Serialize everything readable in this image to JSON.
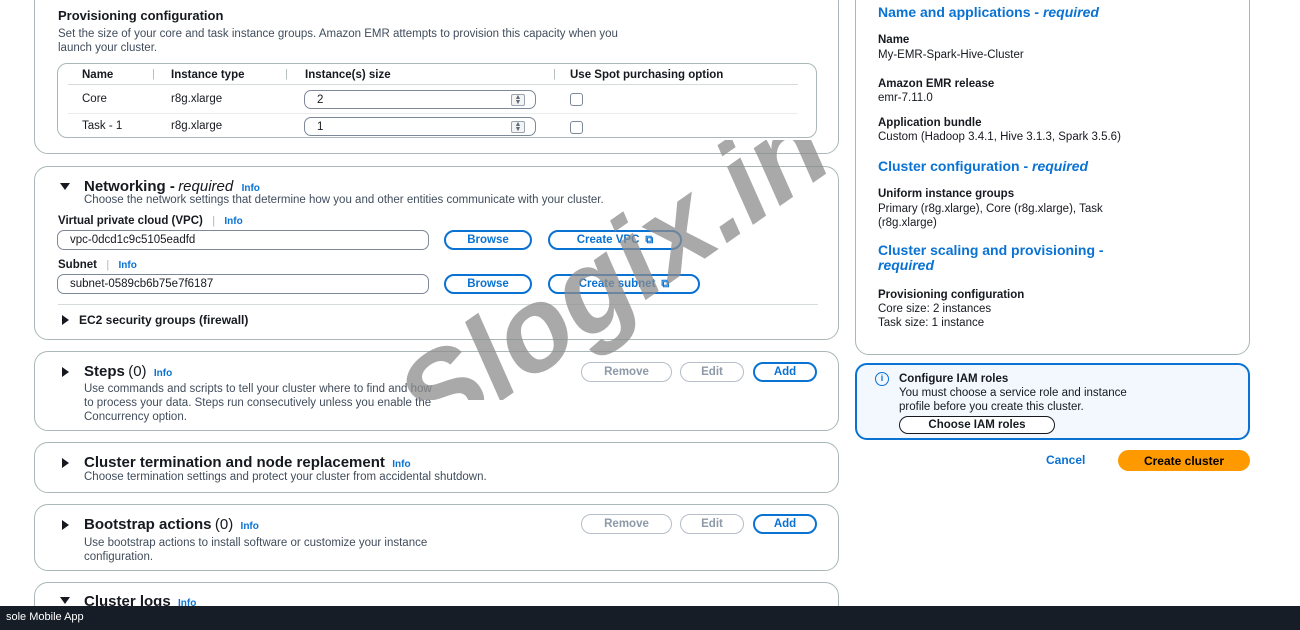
{
  "provisioning": {
    "title": "Provisioning configuration",
    "desc_line1": "Set the size of your core and task instance groups. Amazon EMR attempts to provision this capacity when you",
    "desc_line2": "launch your cluster.",
    "headers": [
      "Name",
      "Instance type",
      "Instance(s) size",
      "Use Spot purchasing option"
    ],
    "rows": [
      {
        "name": "Core",
        "type": "r8g.xlarge",
        "size": "2"
      },
      {
        "name": "Task - 1",
        "type": "r8g.xlarge",
        "size": "1"
      }
    ]
  },
  "networking": {
    "title": "Networking -",
    "required": "required",
    "info": "Info",
    "desc": "Choose the network settings that determine how you and other entities communicate with your cluster.",
    "vpc_label": "Virtual private cloud (VPC)",
    "vpc_info": "Info",
    "vpc_value": "vpc-0dcd1c9c5105eadfd",
    "browse": "Browse",
    "create_vpc": "Create VPC",
    "subnet_label": "Subnet",
    "subnet_info": "Info",
    "subnet_value": "subnet-0589cb6b75e7f6187",
    "create_subnet": "Create subnet",
    "security_groups": "EC2 security groups (firewall)"
  },
  "steps": {
    "title": "Steps",
    "count": "(0)",
    "info": "Info",
    "desc_line1": "Use commands and scripts to tell your cluster where to find and how",
    "desc_line2": "to process your data. Steps run consecutively unless you enable the",
    "desc_line3": "Concurrency option.",
    "remove": "Remove",
    "edit": "Edit",
    "add": "Add"
  },
  "termination": {
    "title": "Cluster termination and node replacement",
    "info": "Info",
    "desc": "Choose termination settings and protect your cluster from accidental shutdown."
  },
  "bootstrap": {
    "title": "Bootstrap actions",
    "count": "(0)",
    "info": "Info",
    "desc_line1": "Use bootstrap actions to install software or customize your instance",
    "desc_line2": "configuration.",
    "remove": "Remove",
    "edit": "Edit",
    "add": "Add"
  },
  "logs": {
    "title": "Cluster logs",
    "info": "Info"
  },
  "summary": {
    "name_apps_title": "Name and applications -",
    "name_apps_required": "required",
    "name_label": "Name",
    "name_value": "My-EMR-Spark-Hive-Cluster",
    "release_label": "Amazon EMR release",
    "release_value": "emr-7.11.0",
    "bundle_label": "Application bundle",
    "bundle_value": "Custom (Hadoop 3.4.1, Hive 3.1.3, Spark 3.5.6)",
    "cluster_conf_title": "Cluster configuration -",
    "cluster_conf_required": "required",
    "uniform_label": "Uniform instance groups",
    "uniform_value_line1": "Primary (r8g.xlarge), Core (r8g.xlarge), Task",
    "uniform_value_line2": "(r8g.xlarge)",
    "scaling_title": "Cluster scaling and provisioning -",
    "scaling_required": "required",
    "prov_label": "Provisioning configuration",
    "core_size": "Core size: 2 instances",
    "task_size": "Task size: 1 instance"
  },
  "iam": {
    "title": "Configure IAM roles",
    "desc_line1": "You must choose a service role and instance",
    "desc_line2": "profile before you create this cluster.",
    "button": "Choose IAM roles"
  },
  "actions": {
    "cancel": "Cancel",
    "create": "Create cluster"
  },
  "watermark": "Slogix.in",
  "bottom_bar": "sole Mobile App",
  "colors": {
    "link_blue": "#0972d3",
    "primary_orange": "#ff9900",
    "info_bg": "#f2f8fd",
    "bar_dark": "#161d26"
  }
}
